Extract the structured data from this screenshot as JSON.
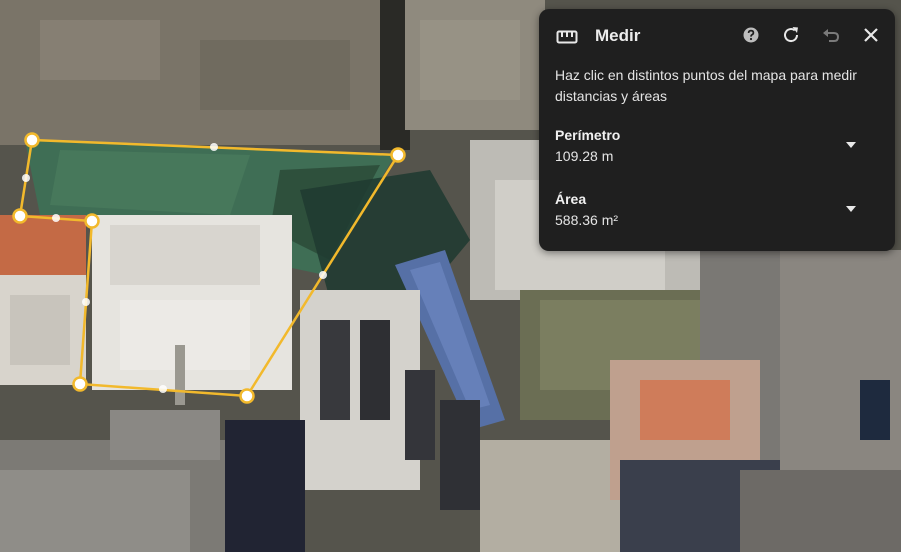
{
  "panel": {
    "title": "Medir",
    "description": "Haz clic en distintos puntos del mapa para medir distancias y áreas",
    "perimeter": {
      "label": "Perímetro",
      "value": "109.28 m"
    },
    "area": {
      "label": "Área",
      "value": "588.36 m²"
    }
  },
  "icons": {
    "ruler": "ruler-icon",
    "help": "help-icon",
    "reset": "reset-icon",
    "undo": "undo-icon",
    "close": "close-icon",
    "expand": "chevron-down-icon"
  },
  "colors": {
    "panel_bg": "#1f1f1f",
    "measure_line": "#f2b92c"
  }
}
